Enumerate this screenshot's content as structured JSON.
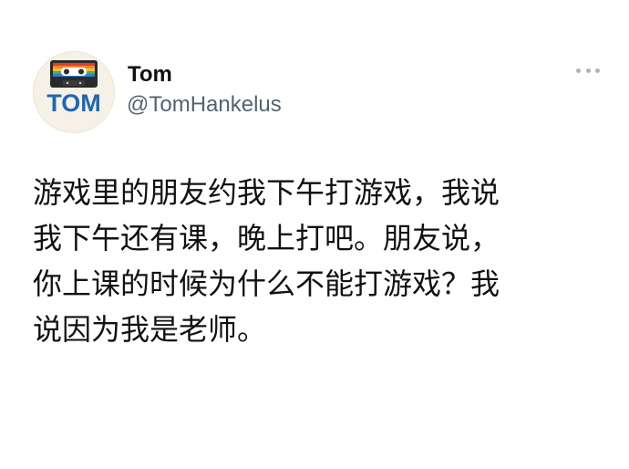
{
  "user": {
    "avatar_text": "TOM",
    "display_name": "Tom",
    "handle": "@TomHankelus"
  },
  "menu": {
    "icon": "more-horizontal-icon"
  },
  "tweet": {
    "lines": [
      "游戏里的朋友约我下午打游戏，我说",
      "我下午还有课，晚上打吧。朋友说，",
      "你上课的时候为什么不能打游戏？我",
      "说因为我是老师。"
    ]
  },
  "colors": {
    "avatar_text": "#1f67b3",
    "avatar_bg": "#f5f1e6",
    "handle": "#536471",
    "more_dots": "#aab4bc"
  }
}
